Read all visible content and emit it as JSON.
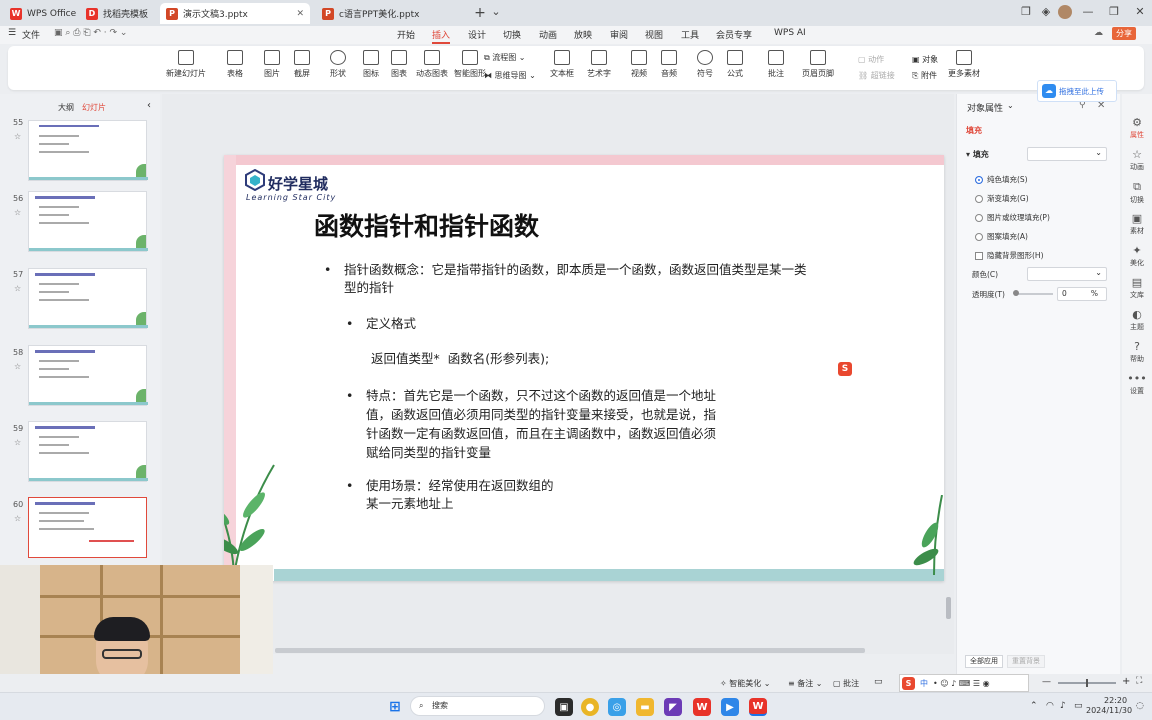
{
  "tabs": [
    {
      "label": "WPS Office",
      "icon": "wps-logo-icon",
      "color": "#e8332a"
    },
    {
      "label": "找稻壳模板",
      "icon": "docer-icon",
      "color": "#e8332a"
    },
    {
      "label": "演示文稿3.pptx",
      "icon": "ppt-icon",
      "color": "#d24726"
    },
    {
      "label": "c语言PPT美化.pptx",
      "icon": "ppt-icon",
      "color": "#d24726"
    }
  ],
  "menu": {
    "file": "文件",
    "items": [
      "开始",
      "插入",
      "设计",
      "切换",
      "动画",
      "放映",
      "审阅",
      "视图",
      "工具",
      "会员专享",
      "WPS AI"
    ],
    "active": "插入",
    "share": "分享"
  },
  "ribbon": {
    "buttons": [
      "新建幻灯片",
      "表格",
      "图片",
      "截屏",
      "形状",
      "图标",
      "图表",
      "动态图表",
      "智能图形",
      "流程图",
      "思维导图",
      "文本框",
      "艺术字",
      "视频",
      "音频",
      "符号",
      "公式",
      "批注",
      "页眉页脚",
      "动作",
      "超链接",
      "对象",
      "附件",
      "更多素材"
    ]
  },
  "leftpanel": {
    "tabs": [
      "大纲",
      "幻灯片"
    ],
    "active_tab": "幻灯片",
    "slides": [
      {
        "num": "55",
        "title": "数组指针和指针数组专项练习"
      },
      {
        "num": "56",
        "title": "数组指针和指针数组专项练习"
      },
      {
        "num": "57",
        "title": "数组指针和指针数组专项练习"
      },
      {
        "num": "58",
        "title": "数组指针和指针数组专项练习"
      },
      {
        "num": "59",
        "title": "数组指针和指针数组专项练习"
      },
      {
        "num": "60",
        "title": "函数指针和指针函数"
      }
    ]
  },
  "slide": {
    "logo_name": "好学星城",
    "logo_sub": "Learning Star City",
    "title": "函数指针和指针函数",
    "bullets": [
      {
        "lines": [
          "指针函数概念：它是指带指针的函数，即本质是一个函数，函数返回值类型是某一类",
          "型的指针"
        ]
      },
      {
        "lines": [
          "定义格式"
        ]
      },
      {
        "lines": [
          "特点：首先它是一个函数，只不过这个函数的返回值是一个地址",
          "值，函数返回值必须用同类型的指针变量来接受，也就是说，指",
          "针函数一定有函数返回值，而且在主调函数中，函数返回值必须",
          "赋给同类型的指针变量"
        ]
      },
      {
        "lines": [
          "使用场景：经常使用在返回数组的",
          "某一元素地址上"
        ]
      }
    ],
    "code": "返回值类型*  函数名(形参列表);"
  },
  "rightpanel": {
    "title": "对象属性",
    "upload_btn": "拖拽至此上传",
    "tab": "填充",
    "section": "填充",
    "options": [
      "纯色填充(S)",
      "渐变填充(G)",
      "图片或纹理填充(P)",
      "图案填充(A)"
    ],
    "selected": "纯色填充(S)",
    "hide_bg": "隐藏背景图形(H)",
    "color_label": "颜色(C)",
    "transparency_label": "透明度(T)",
    "transparency_value": "0",
    "transparency_unit": "%",
    "apply_all": "全部应用",
    "reset_bg": "重置背景"
  },
  "iconbar": [
    "属性",
    "动画",
    "切换",
    "素材",
    "美化",
    "文库",
    "主题",
    "帮助",
    "设置"
  ],
  "statusbar": {
    "smart": "智能美化",
    "notes": "备注",
    "comments": "批注"
  },
  "taskbar": {
    "search": "搜索",
    "time": "22:20",
    "date": "2024/11/30",
    "ime": "中"
  }
}
